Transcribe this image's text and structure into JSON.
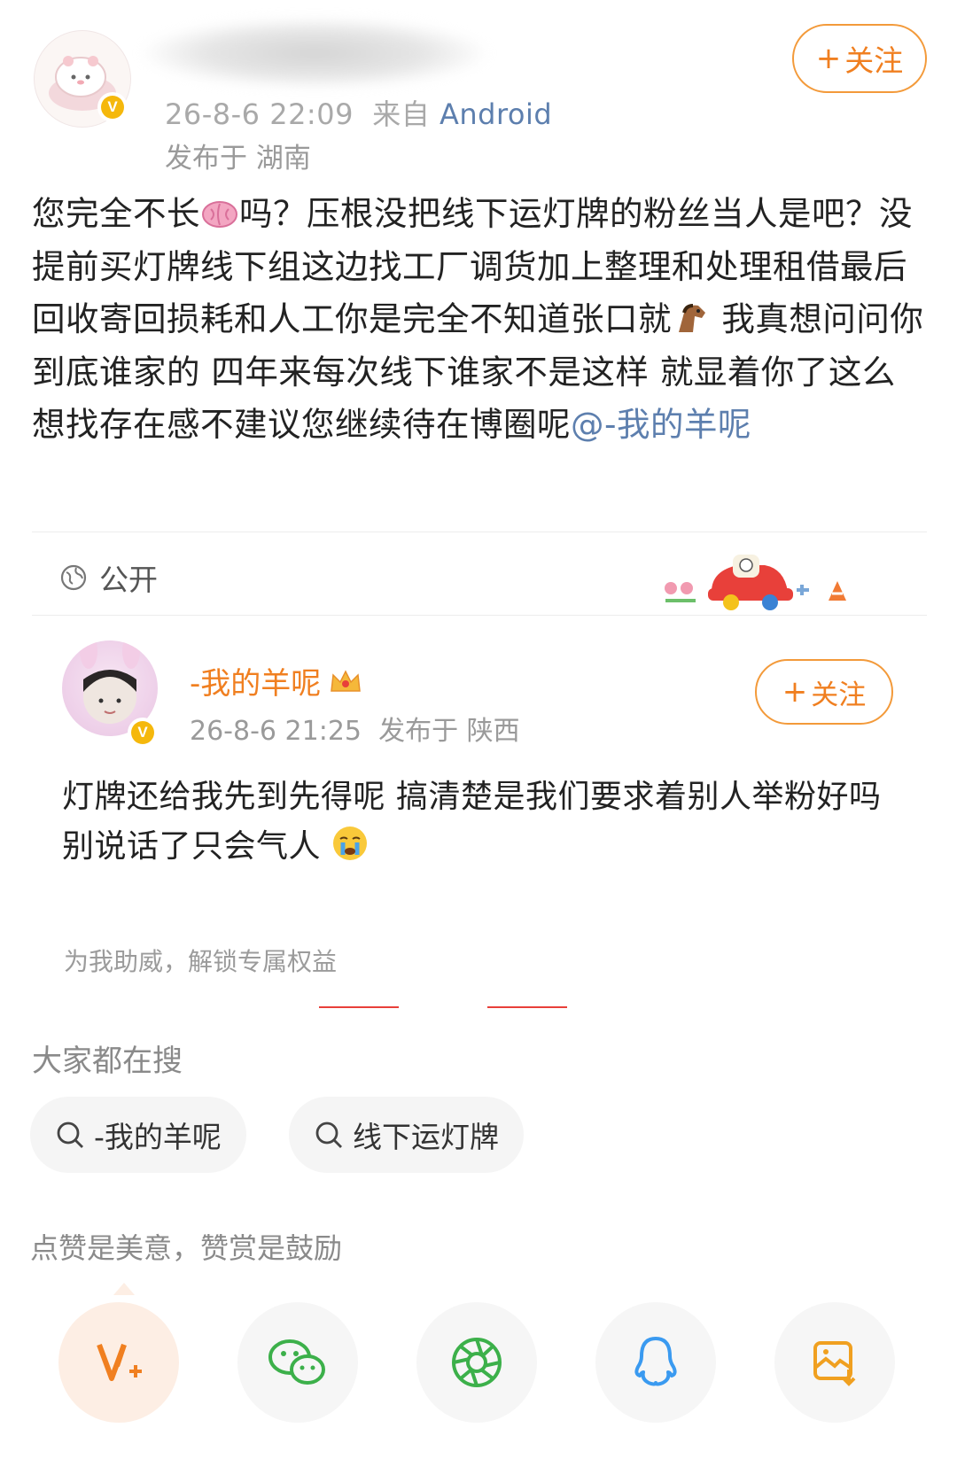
{
  "post": {
    "author_verified_icon": "v-badge-icon",
    "time": "26-8-6 22:09",
    "source_prefix": "来自",
    "source": "Android",
    "location": "发布于 湖南",
    "follow_label": "关注",
    "body_1": "您完全不长",
    "body_emoji_1": "brain-emoji",
    "body_2": "吗？压根没把线下运灯牌的粉丝当人是吧？没提前买灯牌线下组这边找工厂调货加上整理和处理租借最后回收寄回损耗和人工你是完全不知道张口就",
    "body_emoji_2": "horse-emoji",
    "body_3": " 我真想问问你到底谁家的 四年来每次线下谁家不是这样 就显着你了这么想找存在感不建议您继续待在博圈呢",
    "mention": "@-我的羊呢",
    "visibility": "公开"
  },
  "quoted": {
    "author": "-我的羊呢",
    "author_badge": "crown-icon",
    "time": "26-8-6 21:25",
    "location": "发布于 陕西",
    "follow_label": "关注",
    "body": "灯牌还给我先到先得呢 搞清楚是我们要求着别人举粉好吗 别说话了只会气人 ",
    "body_emoji": "crying-emoji",
    "cheer_text": "为我助威，解锁专属权益"
  },
  "search": {
    "title": "大家都在搜",
    "chips": [
      "-我的羊呢",
      "线下运灯牌"
    ]
  },
  "like_note": "点赞是美意，赞赏是鼓励",
  "share": [
    {
      "icon": "vplus-icon",
      "color": "#f07f20"
    },
    {
      "icon": "wechat-icon",
      "color": "#3cb04a"
    },
    {
      "icon": "moments-icon",
      "color": "#3cb04a"
    },
    {
      "icon": "qq-icon",
      "color": "#3a9af0"
    },
    {
      "icon": "save-image-icon",
      "color": "#f0a020"
    }
  ]
}
